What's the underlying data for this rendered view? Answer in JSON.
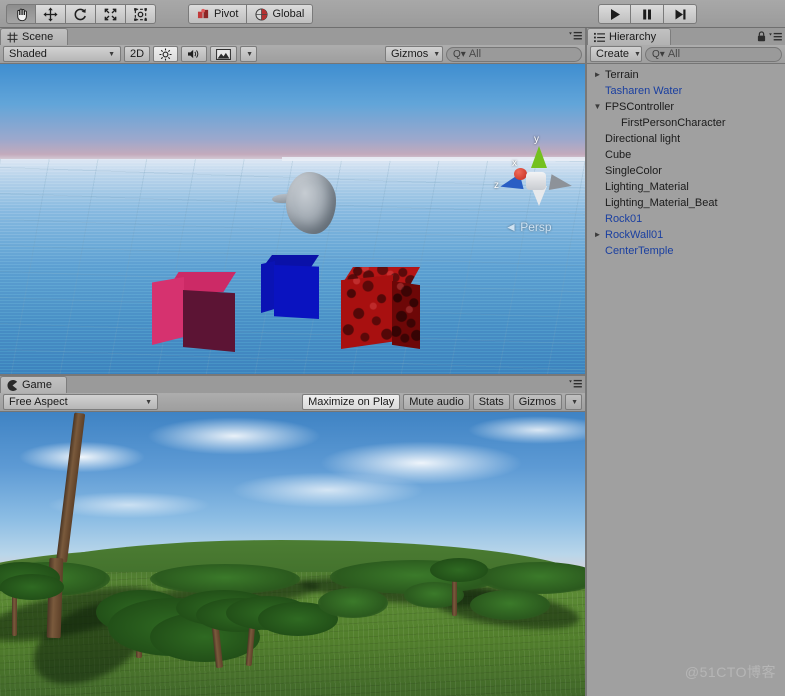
{
  "toolbar": {
    "transform_tools": [
      {
        "name": "hand-tool",
        "icon": "hand-icon",
        "active": true
      },
      {
        "name": "move-tool",
        "icon": "move-icon",
        "active": false
      },
      {
        "name": "rotate-tool",
        "icon": "rotate-icon",
        "active": false
      },
      {
        "name": "scale-tool",
        "icon": "scale-icon",
        "active": false
      },
      {
        "name": "rect-tool",
        "icon": "rect-transform-icon",
        "active": false
      }
    ],
    "pivot_label": "Pivot",
    "global_label": "Global",
    "play_label": "Play",
    "pause_label": "Pause",
    "step_label": "Step"
  },
  "scene": {
    "tab_label": "Scene",
    "draw_mode": "Shaded",
    "toggle_2d": "2D",
    "lighting_label": "Lighting",
    "audio_label": "Audio",
    "effects_label": "Effects",
    "gizmos_label": "Gizmos",
    "search_placeholder": "All",
    "search_value": "",
    "view_mode": "Persp",
    "gizmo_axes": [
      "x",
      "y",
      "z"
    ]
  },
  "game": {
    "tab_label": "Game",
    "aspect": "Free Aspect",
    "maximize_label": "Maximize on Play",
    "mute_label": "Mute audio",
    "stats_label": "Stats",
    "gizmos_label": "Gizmos"
  },
  "hierarchy": {
    "tab_label": "Hierarchy",
    "create_label": "Create",
    "search_placeholder": "All",
    "search_value": "",
    "items": [
      {
        "label": "Terrain",
        "indent": 0,
        "arrow": "collapsed",
        "prefab": false
      },
      {
        "label": "Tasharen Water",
        "indent": 1,
        "arrow": "none",
        "prefab": true
      },
      {
        "label": "FPSController",
        "indent": 0,
        "arrow": "expanded",
        "prefab": false
      },
      {
        "label": "FirstPersonCharacter",
        "indent": 2,
        "arrow": "none",
        "prefab": false
      },
      {
        "label": "Directional light",
        "indent": 1,
        "arrow": "none",
        "prefab": false
      },
      {
        "label": "Cube",
        "indent": 1,
        "arrow": "none",
        "prefab": false
      },
      {
        "label": "SingleColor",
        "indent": 1,
        "arrow": "none",
        "prefab": false
      },
      {
        "label": "Lighting_Material",
        "indent": 1,
        "arrow": "none",
        "prefab": false
      },
      {
        "label": "Lighting_Material_Beat",
        "indent": 1,
        "arrow": "none",
        "prefab": false
      },
      {
        "label": "Rock01",
        "indent": 1,
        "arrow": "none",
        "prefab": true
      },
      {
        "label": "RockWall01",
        "indent": 0,
        "arrow": "collapsed",
        "prefab": true
      },
      {
        "label": "CenterTemple",
        "indent": 1,
        "arrow": "none",
        "prefab": true
      }
    ]
  },
  "watermark": "@51CTO博客",
  "colors": {
    "chrome": "#a0a0a0",
    "prefab_blue": "#1a3fa0",
    "axis_x": "#d93a2b",
    "axis_y": "#74c11e",
    "axis_z": "#2a5ec4"
  }
}
